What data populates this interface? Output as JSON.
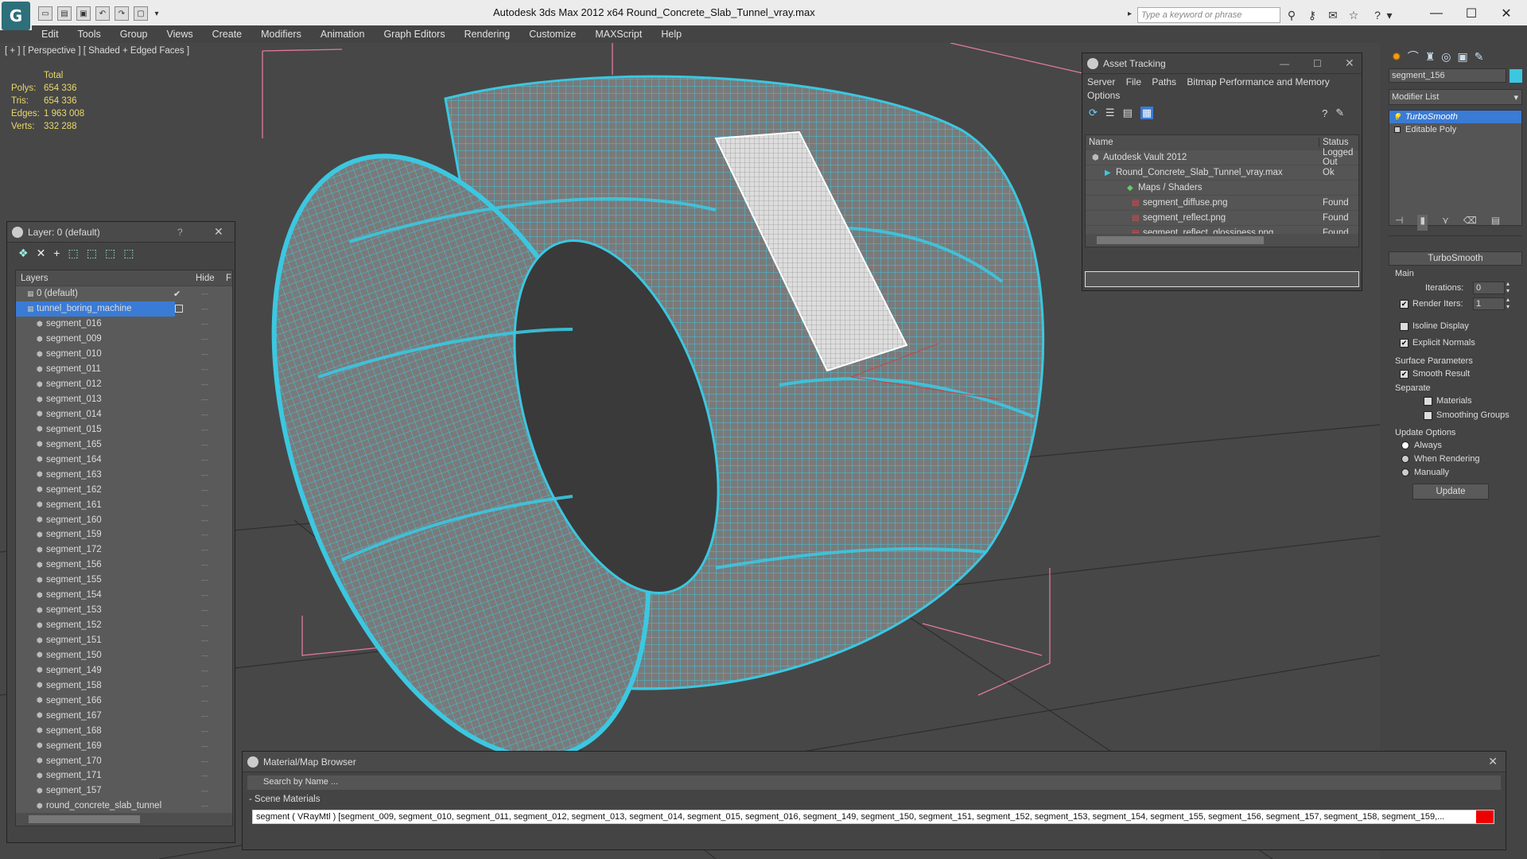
{
  "window": {
    "title": "Autodesk 3ds Max  2012 x64      Round_Concrete_Slab_Tunnel_vray.max",
    "search_placeholder": "Type a keyword or phrase"
  },
  "menu": [
    "Edit",
    "Tools",
    "Group",
    "Views",
    "Create",
    "Modifiers",
    "Animation",
    "Graph Editors",
    "Rendering",
    "Customize",
    "MAXScript",
    "Help"
  ],
  "viewport": {
    "label": "[ + ] [ Perspective ] [ Shaded + Edged Faces ]",
    "stats": {
      "header": "Total",
      "polys_label": "Polys:",
      "polys": "654 336",
      "tris_label": "Tris:",
      "tris": "654 336",
      "edges_label": "Edges:",
      "edges": "1 963 008",
      "verts_label": "Verts:",
      "verts": "332 288"
    }
  },
  "layer_panel": {
    "title": "Layer: 0 (default)",
    "help": "?",
    "col_layers": "Layers",
    "col_hide": "Hide",
    "col_f": "F",
    "rows": [
      "0 (default)",
      "tunnel_boring_machine",
      "segment_016",
      "segment_009",
      "segment_010",
      "segment_011",
      "segment_012",
      "segment_013",
      "segment_014",
      "segment_015",
      "segment_165",
      "segment_164",
      "segment_163",
      "segment_162",
      "segment_161",
      "segment_160",
      "segment_159",
      "segment_172",
      "segment_156",
      "segment_155",
      "segment_154",
      "segment_153",
      "segment_152",
      "segment_151",
      "segment_150",
      "segment_149",
      "segment_158",
      "segment_166",
      "segment_167",
      "segment_168",
      "segment_169",
      "segment_170",
      "segment_171",
      "segment_157",
      "round_concrete_slab_tunnel"
    ]
  },
  "asset_panel": {
    "title": "Asset Tracking",
    "menu": [
      "Server",
      "File",
      "Paths",
      "Bitmap Performance and Memory",
      "Options"
    ],
    "col_name": "Name",
    "col_status": "Status",
    "rows": [
      {
        "name": "Autodesk Vault 2012",
        "status": "Logged Out"
      },
      {
        "name": "Round_Concrete_Slab_Tunnel_vray.max",
        "status": "Ok"
      },
      {
        "name": "Maps / Shaders",
        "status": ""
      },
      {
        "name": "segment_diffuse.png",
        "status": "Found"
      },
      {
        "name": "segment_reflect.png",
        "status": "Found"
      },
      {
        "name": "segment_reflect_glossiness.png",
        "status": "Found"
      }
    ]
  },
  "command_panel": {
    "object_name": "segment_156",
    "modifier_list": "Modifier List",
    "stack": [
      "TurboSmooth",
      "Editable Poly"
    ],
    "rollout_title": "TurboSmooth",
    "main_label": "Main",
    "iterations_label": "Iterations:",
    "iterations": "0",
    "render_iters_label": "Render Iters:",
    "render_iters": "1",
    "isoline": "Isoline Display",
    "explicit_normals": "Explicit Normals",
    "surface_params": "Surface Parameters",
    "smooth_result": "Smooth Result",
    "separate": "Separate",
    "materials": "Materials",
    "smoothing_groups": "Smoothing Groups",
    "update_options": "Update Options",
    "always": "Always",
    "when_rendering": "When Rendering",
    "manually": "Manually",
    "update_btn": "Update"
  },
  "material_browser": {
    "title": "Material/Map Browser",
    "search": "Search by Name ...",
    "section": "- Scene Materials",
    "item": "segment  ( VRayMtl )  [segment_009, segment_010, segment_011, segment_012, segment_013, segment_014, segment_015, segment_016, segment_149, segment_150, segment_151, segment_152, segment_153, segment_154, segment_155, segment_156, segment_157, segment_158, segment_159,..."
  },
  "colors": {
    "wire": "#3cc7e0",
    "accent": "#3a7bd5",
    "viewport_bg": "#474747"
  }
}
